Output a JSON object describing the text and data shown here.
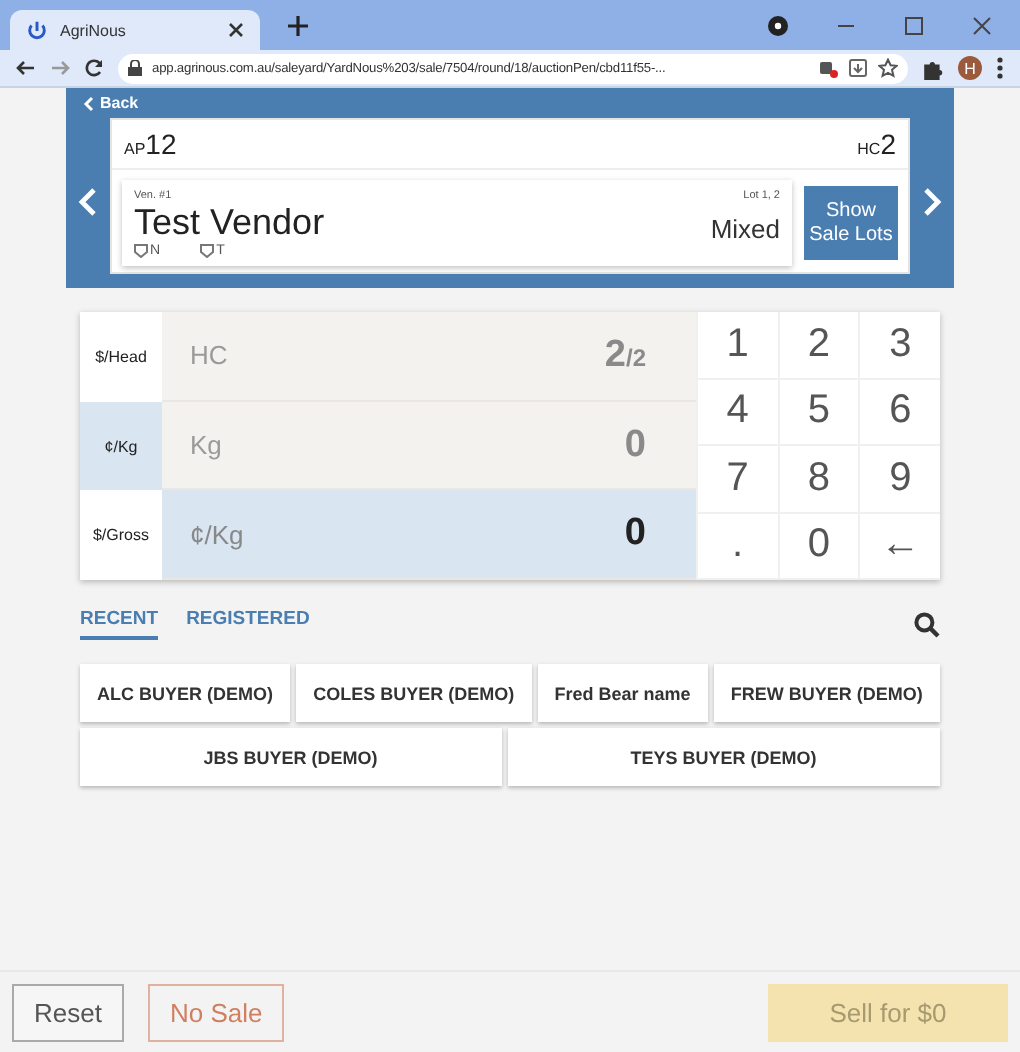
{
  "browser": {
    "tab_title": "AgriNous",
    "url": "app.agrinous.com.au/saleyard/YardNous%203/sale/7504/round/18/auctionPen/cbd11f55-...",
    "profile_initial": "H"
  },
  "header": {
    "back": "Back",
    "ap_label": "AP",
    "ap_value": "12",
    "hc_label": "HC",
    "hc_value": "2"
  },
  "vendor": {
    "number": "Ven. #1",
    "lots": "Lot 1, 2",
    "name": "Test Vendor",
    "type": "Mixed",
    "tags": [
      "N",
      "T"
    ],
    "button": "Show Sale Lots"
  },
  "price_units": [
    {
      "label": "$/Head",
      "selected": false
    },
    {
      "label": "¢/Kg",
      "selected": true
    },
    {
      "label": "$/Gross",
      "selected": false
    }
  ],
  "fields": [
    {
      "label": "HC",
      "value": "2",
      "suffix": "/2",
      "active": false
    },
    {
      "label": "Kg",
      "value": "0",
      "active": false
    },
    {
      "label": "¢/Kg",
      "value": "0",
      "active": true
    }
  ],
  "keypad": [
    "1",
    "2",
    "3",
    "4",
    "5",
    "6",
    "7",
    "8",
    "9",
    ".",
    "0",
    "←"
  ],
  "buyer_tabs": [
    {
      "label": "RECENT",
      "selected": true
    },
    {
      "label": "REGISTERED",
      "selected": false
    }
  ],
  "buyers": [
    [
      "ALC BUYER (DEMO)",
      "COLES BUYER (DEMO)",
      "Fred Bear name",
      "FREW BUYER (DEMO)"
    ],
    [
      "JBS BUYER (DEMO)",
      "TEYS BUYER (DEMO)"
    ]
  ],
  "footer": {
    "reset": "Reset",
    "no_sale": "No Sale",
    "sell": "Sell for $0",
    "sell_disabled": true
  }
}
